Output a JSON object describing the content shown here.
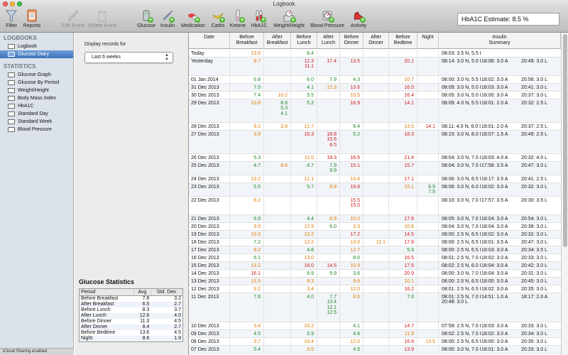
{
  "window": {
    "title": "Logbook"
  },
  "toolbar": {
    "items": [
      {
        "label": "Filter",
        "icon": "filter-icon"
      },
      {
        "label": "Reports",
        "icon": "reports-icon"
      },
      {
        "label": "Edit Event",
        "icon": "edit-event-icon",
        "enabled": false
      },
      {
        "label": "Delete Event",
        "icon": "trash-icon",
        "enabled": false
      },
      {
        "label": "Glucose",
        "icon": "glucose-meter-icon"
      },
      {
        "label": "Insulin",
        "icon": "syringe-icon"
      },
      {
        "label": "Medication",
        "icon": "pills-icon"
      },
      {
        "label": "Carbs",
        "icon": "banana-icon"
      },
      {
        "label": "Ketone",
        "icon": "ketone-icon"
      },
      {
        "label": "HbA1C",
        "icon": "test-tube-icon"
      },
      {
        "label": "Weight/Height",
        "icon": "scale-icon"
      },
      {
        "label": "Blood Pressure",
        "icon": "blood-pressure-icon"
      },
      {
        "label": "Activity",
        "icon": "running-shoes-icon"
      }
    ],
    "hba1c": "HbA1C Estimate: 8.5 %"
  },
  "sidebar": {
    "logbooks_header": "LOGBOOKS",
    "logbooks": [
      {
        "label": "Logbook"
      },
      {
        "label": "Glucose Diary",
        "selected": true
      }
    ],
    "statistics_header": "STATISTICS",
    "statistics": [
      {
        "label": "Glucose Graph"
      },
      {
        "label": "Glucose By Period"
      },
      {
        "label": "Weight/Height"
      },
      {
        "label": "Body Mass Index"
      },
      {
        "label": "HbA1C"
      },
      {
        "label": "Standard Day"
      },
      {
        "label": "Standard Week"
      },
      {
        "label": "Blood Pressure"
      }
    ],
    "footer": "iCloud Sharing enabled"
  },
  "filter": {
    "label": "Display records for",
    "value": "Last 6 weeks"
  },
  "glucose_stats": {
    "title": "Glucose Statistics",
    "headers": [
      "Period",
      "Avg",
      "Std. Dev."
    ],
    "rows": [
      [
        "Before Breakfast",
        "7.8",
        "3.2"
      ],
      [
        "After Breakfast",
        "6.5",
        "2.7"
      ],
      [
        "Before Lunch",
        "8.3",
        "3.7"
      ],
      [
        "After Lunch",
        "12.6",
        "4.0"
      ],
      [
        "Before Dinner",
        "11.3",
        "4.5"
      ],
      [
        "After Dinner",
        "8.4",
        "2.7"
      ],
      [
        "Before Bedtime",
        "13.6",
        "4.5"
      ],
      [
        "Night",
        "8.6",
        "1.9"
      ]
    ]
  },
  "colors": {
    "low": "#1e8a1e",
    "mid": "#e07b00",
    "high": "#d01818",
    "selection": "#3e73bb"
  },
  "diary": {
    "columns": [
      "Date",
      "Before\nBreakfast",
      "After\nBreakfast",
      "Before\nLunch",
      "After\nLunch",
      "Before\nDinner",
      "After\nDinner",
      "Before\nBedtime",
      "Night",
      "Insulin\nSummary"
    ],
    "rows": [
      {
        "date": "Today",
        "h": 1,
        "v": [
          "13.0",
          "",
          "6.4",
          "",
          "",
          "",
          "",
          ""
        ],
        "c": [
          "m",
          "",
          "g",
          "",
          "",
          "",
          "",
          ""
        ],
        "ins": [
          [
            "08:03: 3.5 N, 5.5 I"
          ]
        ]
      },
      {
        "date": "Yesterday",
        "h": 3,
        "v": [
          "8.7",
          "",
          "12.3\n11.1",
          "17.4",
          "13.5",
          "",
          "20.1",
          ""
        ],
        "c": [
          "m",
          "",
          "r",
          "r",
          "r",
          "",
          "r",
          ""
        ],
        "ins": [
          [
            "08:14: 3.0 N, 5.0 I",
            "18:06: 3.0 A",
            "20:49: 3.0 L"
          ]
        ]
      },
      {
        "date": "01 Jan 2014",
        "h": 1,
        "v": [
          "6.8",
          "",
          "6.0",
          "7.9",
          "4.3",
          "",
          "10.7",
          ""
        ],
        "c": [
          "g",
          "",
          "g",
          "g",
          "g",
          "",
          "m",
          ""
        ],
        "ins": [
          [
            "08:00: 3.0 N, 5.5 I",
            "18:02: 3.0 A",
            "20:56: 3.0 L"
          ]
        ]
      },
      {
        "date": "31 Dec 2013",
        "h": 1,
        "v": [
          "7.0",
          "",
          "4.1",
          "12.3",
          "13.6",
          "",
          "16.5",
          ""
        ],
        "c": [
          "g",
          "",
          "g",
          "m",
          "r",
          "",
          "r",
          ""
        ],
        "ins": [
          [
            "08:09: 3.0 N, 5.0 I",
            "18:03: 3.0 A",
            "20:41: 3.0 L"
          ]
        ]
      },
      {
        "date": "30 Dec 2013",
        "h": 1,
        "v": [
          "7.4",
          "10.2",
          "5.5",
          "",
          "10.5",
          "",
          "16.4",
          ""
        ],
        "c": [
          "g",
          "m",
          "g",
          "",
          "m",
          "",
          "r",
          ""
        ],
        "ins": [
          [
            "08:05: 3.0 N, 5.0 I",
            "18:00: 3.0 A",
            "20:37: 3.0 L"
          ]
        ]
      },
      {
        "date": "29 Dec 2013",
        "h": 4,
        "v": [
          "10.8",
          "8.8\n5.3\n4.1",
          "5.2",
          "",
          "16.9",
          "",
          "14.1",
          ""
        ],
        "c": [
          "m",
          "g",
          "g",
          "",
          "r",
          "",
          "r",
          ""
        ],
        "ins": [
          [
            "08:09: 4.0 N, 5.5 I",
            "18:01: 2.0 A",
            "20:32: 2.5 L"
          ]
        ]
      },
      {
        "date": "28 Dec 2013",
        "h": 1,
        "v": [
          "9.2",
          "3.8",
          "12.7",
          "",
          "6.4",
          "",
          "13.5",
          "14.1"
        ],
        "c": [
          "m",
          "m",
          "m",
          "",
          "g",
          "",
          "m",
          "r"
        ],
        "ins": [
          [
            "08:11: 4.0 N, 6.0 I",
            "18:01: 2.0 A",
            "20:37: 2.5 L"
          ]
        ]
      },
      {
        "date": "27 Dec 2013",
        "h": 4,
        "v": [
          "3.9",
          "",
          "16.3",
          "18.8\n15.6\n8.5",
          "5.2",
          "",
          "18.3",
          ""
        ],
        "c": [
          "m",
          "",
          "r",
          "r",
          "g",
          "",
          "r",
          ""
        ],
        "ins": [
          [
            "08:15: 3.0 N, 8.0 I",
            "18:07: 1.5 A",
            "20:49: 2.5 L"
          ]
        ]
      },
      {
        "date": "26 Dec 2013",
        "h": 1,
        "v": [
          "5.3",
          "",
          "11.0",
          "18.3",
          "16.5",
          "",
          "21.4",
          ""
        ],
        "c": [
          "g",
          "",
          "m",
          "r",
          "r",
          "",
          "r",
          ""
        ],
        "ins": [
          [
            "08:04: 3.0 N, 7.0 I",
            "18:03: 4.0 A",
            "20:32: 4.0 L"
          ]
        ]
      },
      {
        "date": "25 Dec 2013",
        "h": 2,
        "v": [
          "4.7",
          "8.6",
          "4.7",
          "7.9\n9.9",
          "15.1",
          "",
          "15.7",
          ""
        ],
        "c": [
          "g",
          "m",
          "g",
          "g",
          "r",
          "",
          "r",
          ""
        ],
        "ins": [
          [
            "08:04: 3.0 N, 7.0 I",
            "17:58: 3.5 A",
            "20:47: 3.0 L"
          ]
        ]
      },
      {
        "date": "24 Dec 2013",
        "h": 1,
        "v": [
          "13.2",
          "",
          "12.1",
          "",
          "13.4",
          "",
          "17.1",
          ""
        ],
        "c": [
          "m",
          "",
          "m",
          "",
          "m",
          "",
          "r",
          ""
        ],
        "ins": [
          [
            "08:06: 3.0 N, 6.5 I",
            "18:17: 3.5 A",
            "20:41: 2.5 L"
          ]
        ]
      },
      {
        "date": "23 Dec 2013",
        "h": 2,
        "v": [
          "5.5",
          "",
          "5.7",
          "9.9",
          "19.8",
          "",
          "10.1",
          "6.9\n7.5"
        ],
        "c": [
          "g",
          "",
          "g",
          "m",
          "r",
          "",
          "m",
          "g"
        ],
        "ins": [
          [
            "08:06: 3.0 N, 6.0 I",
            "18:02: 3.0 A",
            "20:32: 3.0 L"
          ]
        ]
      },
      {
        "date": "22 Dec 2013",
        "h": 3,
        "v": [
          "8.2",
          "",
          "",
          "",
          "15.5\n15.0",
          "",
          "",
          ""
        ],
        "c": [
          "m",
          "",
          "",
          "",
          "r",
          "",
          "",
          ""
        ],
        "ins": [
          [
            "08:10: 3.0 N, 7.0 I",
            "17:57: 3.5 A",
            "20:30: 3.5 L"
          ]
        ]
      },
      {
        "date": "21 Dec 2013",
        "h": 1,
        "v": [
          "6.9",
          "",
          "4.4",
          "8.9",
          "10.0",
          "",
          "17.6",
          ""
        ],
        "c": [
          "g",
          "",
          "g",
          "m",
          "m",
          "",
          "r",
          ""
        ],
        "ins": [
          [
            "08:05: 3.0 N, 7.0 I",
            "18:04: 3.0 A",
            "20:54: 3.0 L"
          ]
        ]
      },
      {
        "date": "20 Dec 2013",
        "h": 1,
        "v": [
          "3.5",
          "",
          "12.9",
          "6.0",
          "3.3",
          "",
          "10.6",
          ""
        ],
        "c": [
          "m",
          "",
          "m",
          "g",
          "m",
          "",
          "m",
          ""
        ],
        "ins": [
          [
            "08:04: 3.0 N, 7.0 I",
            "18:04: 3.0 A",
            "20:38: 3.0 L"
          ]
        ]
      },
      {
        "date": "19 Dec 2013",
        "h": 1,
        "v": [
          "10.3",
          "",
          "13.2",
          "",
          "17.2",
          "",
          "14.5",
          ""
        ],
        "c": [
          "m",
          "",
          "m",
          "",
          "r",
          "",
          "r",
          ""
        ],
        "ins": [
          [
            "08:00: 2.5 N, 6.5 I",
            "18:02: 3.0 A",
            "20:32: 3.0 L"
          ]
        ]
      },
      {
        "date": "18 Dec 2013",
        "h": 1,
        "v": [
          "7.2",
          "",
          "12.2",
          "",
          "13.0",
          "11.1",
          "17.8",
          ""
        ],
        "c": [
          "g",
          "",
          "m",
          "",
          "m",
          "m",
          "r",
          ""
        ],
        "ins": [
          [
            "08:00: 2.5 N, 6.5 I",
            "18:01: 3.5 A",
            "20:47: 3.0 L"
          ]
        ]
      },
      {
        "date": "17 Dec 2013",
        "h": 1,
        "v": [
          "8.2",
          "",
          "4.8",
          "",
          "12.7",
          "",
          "5.9",
          ""
        ],
        "c": [
          "m",
          "",
          "g",
          "",
          "m",
          "",
          "g",
          ""
        ],
        "ins": [
          [
            "08:00: 2.5 N, 6.5 I",
            "18:03: 3.0 A",
            "20:34: 3.5 L"
          ]
        ]
      },
      {
        "date": "16 Dec 2013",
        "h": 1,
        "v": [
          "5.1",
          "",
          "13.0",
          "",
          "8.0",
          "",
          "16.5",
          ""
        ],
        "c": [
          "g",
          "",
          "m",
          "",
          "g",
          "",
          "r",
          ""
        ],
        "ins": [
          [
            "08:01: 2.5 N, 7.0 I",
            "18:02: 3.0 A",
            "20:33: 3.0 L"
          ]
        ]
      },
      {
        "date": "15 Dec 2013",
        "h": 1,
        "v": [
          "13.2",
          "",
          "16.0",
          "14.5",
          "10.9",
          "",
          "17.5",
          ""
        ],
        "c": [
          "m",
          "",
          "r",
          "r",
          "m",
          "",
          "r",
          ""
        ],
        "ins": [
          [
            "08:02: 2.5 N, 6.0 I",
            "18:04: 3.0 A",
            "20:42: 3.0 L"
          ]
        ]
      },
      {
        "date": "14 Dec 2013",
        "h": 1,
        "v": [
          "16.1",
          "",
          "6.9",
          "9.9",
          "3.6",
          "",
          "20.9",
          ""
        ],
        "c": [
          "r",
          "",
          "g",
          "g",
          "g",
          "",
          "r",
          ""
        ],
        "ins": [
          [
            "08:00: 3.0 N, 7.0 I",
            "18:04: 3.0 A",
            "20:31: 3.0 L"
          ]
        ]
      },
      {
        "date": "13 Dec 2013",
        "h": 1,
        "v": [
          "13.5",
          "",
          "8.3",
          "",
          "9.6",
          "",
          "10.1",
          ""
        ],
        "c": [
          "m",
          "",
          "m",
          "",
          "m",
          "",
          "m",
          ""
        ],
        "ins": [
          [
            "08:00: 2.5 N, 6.5 I",
            "18:00: 3.0 A",
            "20:45: 3.0 L"
          ]
        ]
      },
      {
        "date": "12 Dec 2013",
        "h": 1,
        "v": [
          "9.2",
          "",
          "3.4",
          "",
          "12.0",
          "",
          "16.2",
          ""
        ],
        "c": [
          "m",
          "",
          "m",
          "",
          "m",
          "",
          "r",
          ""
        ],
        "ins": [
          [
            "08:01: 2.5 N, 6.5 I",
            "18:02: 3.0 A",
            "20:35: 3.0 L"
          ]
        ]
      },
      {
        "date": "11 Dec 2013",
        "h": 5,
        "v": [
          "7.6",
          "",
          "4.0",
          "7.7\n13.4\n12.1\n12.5",
          "8.6",
          "",
          "7.0",
          ""
        ],
        "c": [
          "g",
          "",
          "g",
          "g",
          "m",
          "",
          "g",
          ""
        ],
        "ins": [
          [
            "08:01: 2.5 N, 7.0 I",
            "14:51: 1.0 A",
            "18:17: 2.0 A"
          ],
          [
            "20:48: 3.0 L"
          ]
        ]
      },
      {
        "date": "10 Dec 2013",
        "h": 1,
        "v": [
          "3.4",
          "",
          "10.2",
          "",
          "4.1",
          "",
          "14.7",
          ""
        ],
        "c": [
          "m",
          "",
          "m",
          "",
          "g",
          "",
          "r",
          ""
        ],
        "ins": [
          [
            "07:59: 2.5 N, 7.0 I",
            "18:03: 3.0 A",
            "20:33: 3.0 L"
          ]
        ]
      },
      {
        "date": "09 Dec 2013",
        "h": 1,
        "v": [
          "4.5",
          "",
          "5.9",
          "",
          "4.8",
          "",
          "11.9",
          ""
        ],
        "c": [
          "g",
          "",
          "g",
          "",
          "g",
          "",
          "m",
          ""
        ],
        "ins": [
          [
            "08:02: 2.5 N, 7.0 I",
            "18:02: 3.0 A",
            "20:34: 3.0 L"
          ]
        ]
      },
      {
        "date": "08 Dec 2013",
        "h": 1,
        "v": [
          "3.7",
          "",
          "10.4",
          "",
          "12.0",
          "",
          "16.8",
          "13.5"
        ],
        "c": [
          "m",
          "",
          "m",
          "",
          "m",
          "",
          "r",
          "m"
        ],
        "ins": [
          [
            "08:00: 2.5 N, 6.5 I",
            "18:00: 3.0 A",
            "20:35: 3.0 L"
          ]
        ]
      },
      {
        "date": "07 Dec 2013",
        "h": 1,
        "v": [
          "5.4",
          "",
          "9.5",
          "",
          "4.9",
          "",
          "13.9",
          ""
        ],
        "c": [
          "g",
          "",
          "m",
          "",
          "g",
          "",
          "r",
          ""
        ],
        "ins": [
          [
            "08:00: 3.0 N, 7.0 I",
            "18:01: 3.0 A",
            "20:33: 3.0 L"
          ]
        ]
      }
    ]
  }
}
